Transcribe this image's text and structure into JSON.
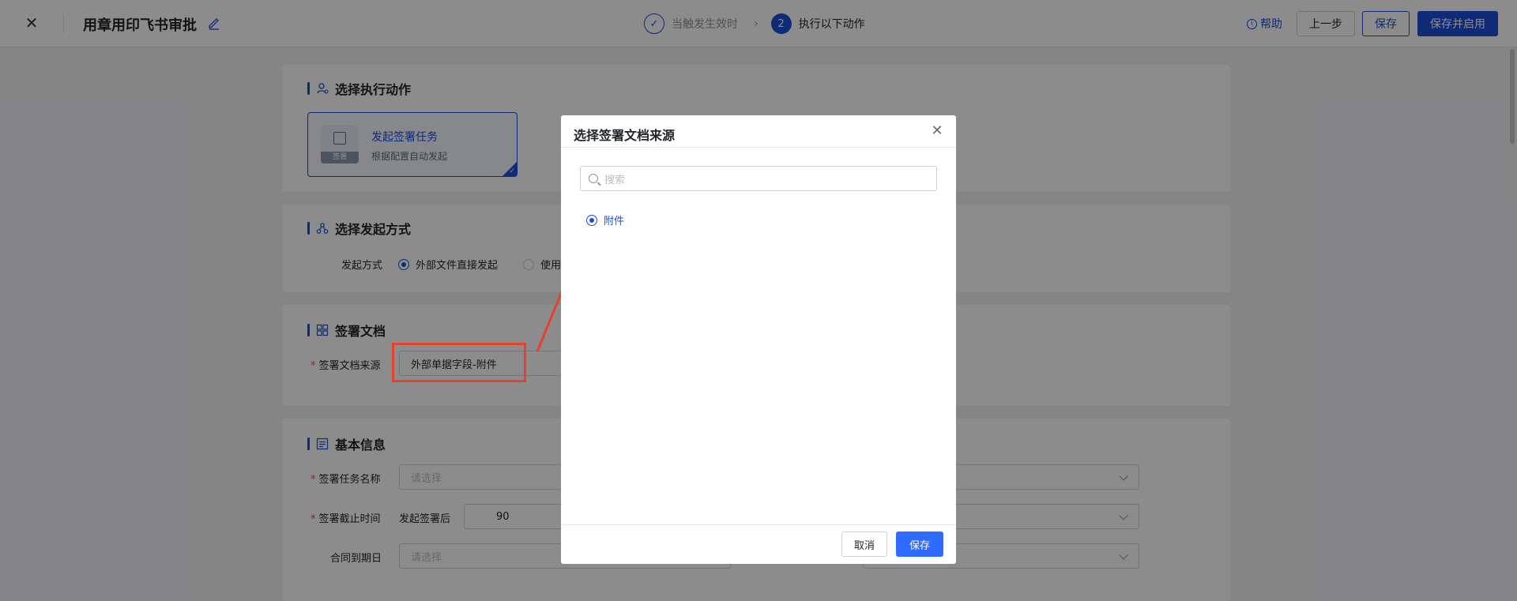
{
  "header": {
    "close_glyph": "✕",
    "title": "用章用印飞书审批",
    "steps": [
      {
        "label": "当触发生效时",
        "glyph": "✓",
        "state": "done"
      },
      {
        "label": "执行以下动作",
        "glyph": "2",
        "state": "active"
      }
    ],
    "step_separator": "›",
    "help_label": "帮助",
    "prev_label": "上一步",
    "save_label": "保存",
    "save_enable_label": "保存并启用"
  },
  "section_action": {
    "title": "选择执行动作",
    "card": {
      "title": "发起签署任务",
      "desc": "根据配置自动发起",
      "icon_caption": "签署"
    }
  },
  "section_method": {
    "title": "选择发起方式",
    "label": "发起方式",
    "options": [
      "外部文件直接发起",
      "使用"
    ]
  },
  "section_doc": {
    "title": "签署文档",
    "label": "签署文档来源",
    "value": "外部单据字段-附件"
  },
  "section_basic": {
    "title": "基本信息",
    "task_name_label": "签署任务名称",
    "task_name_placeholder": "请选择",
    "deadline_label": "签署截止时间",
    "deadline_prefix": "发起签署后",
    "deadline_value": "90",
    "expire_label": "合同到期日",
    "expire_placeholder": "请选择"
  },
  "dialog": {
    "title": "选择签署文档来源",
    "close_glyph": "✕",
    "search_placeholder": "搜索",
    "options": [
      "附件"
    ],
    "cancel_label": "取消",
    "save_label": "保存"
  },
  "colors": {
    "primary": "#1c4ed8",
    "dialog_primary": "#2e6bff",
    "annotation": "#e8402f"
  }
}
